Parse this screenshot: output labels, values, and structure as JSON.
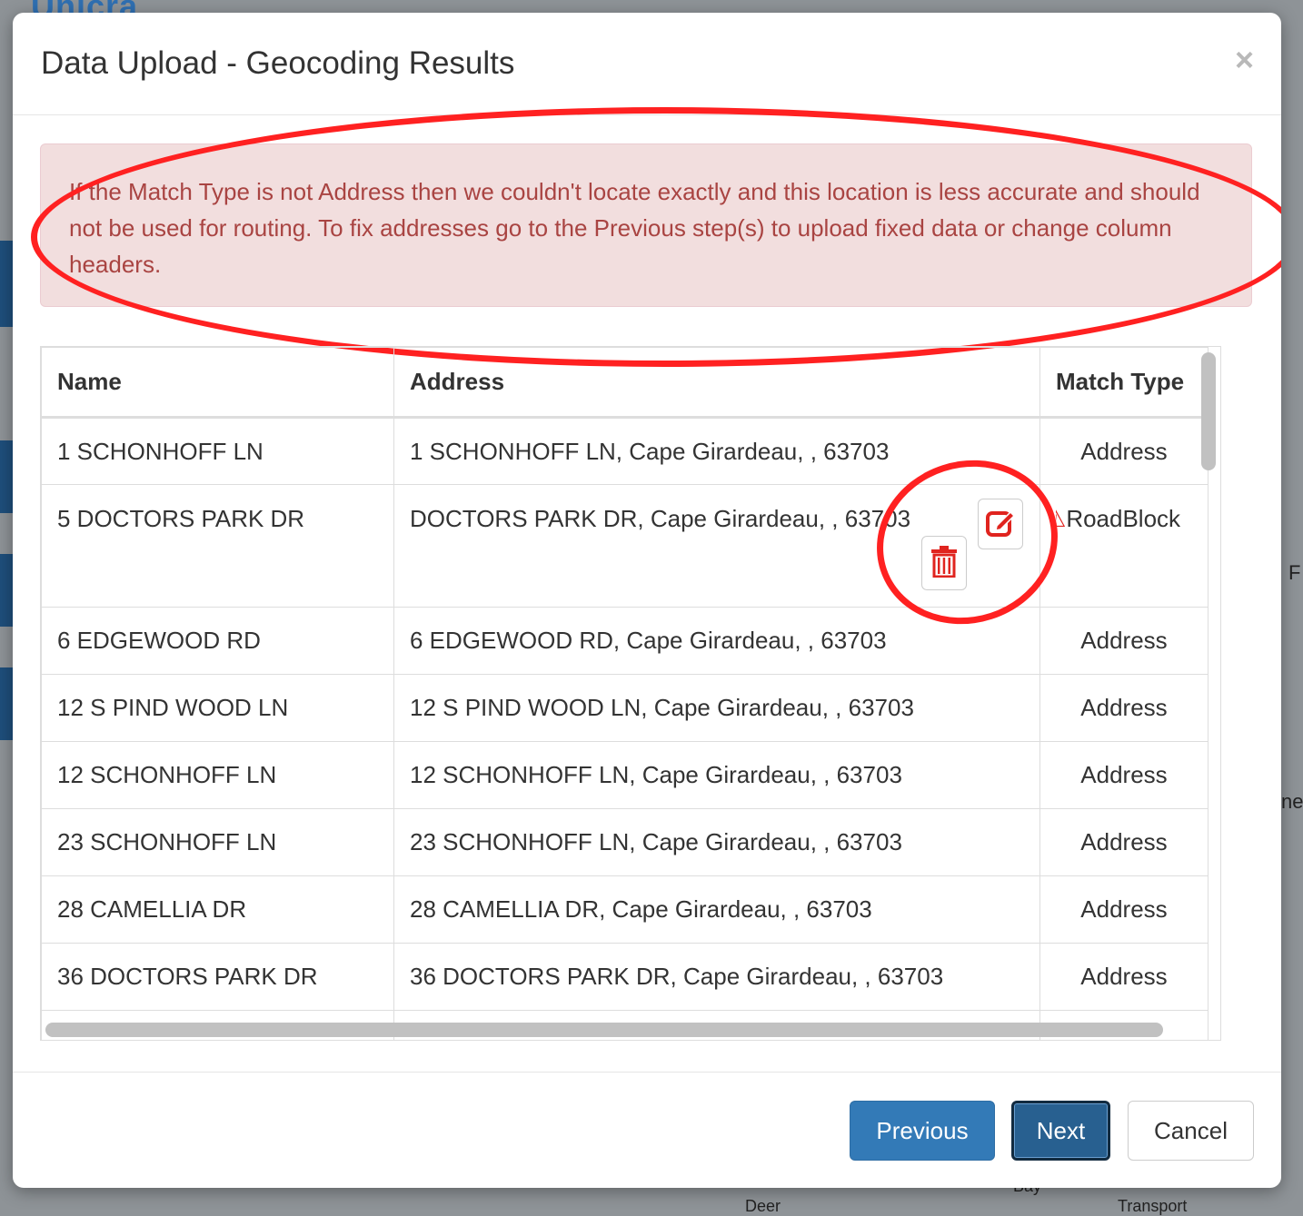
{
  "background": {
    "logo_text": "Unicra",
    "side_text_1": "F",
    "side_text_2": "ne",
    "side_text_3": "Deer",
    "side_text_4": "Bay",
    "side_text_5": "Transport"
  },
  "modal": {
    "title": "Data Upload - Geocoding Results",
    "close_label": "×",
    "alert_text": "If the Match Type is not Address then we couldn't locate exactly and this location is less accurate and should not be used for routing. To fix addresses go to the Previous step(s) to upload fixed data or change column headers.",
    "table": {
      "headers": [
        "Name",
        "Address",
        "Match Type"
      ],
      "rows": [
        {
          "name": "1 SCHONHOFF LN",
          "address": "1 SCHONHOFF LN, Cape Girardeau, , 63703",
          "match": "Address"
        },
        {
          "name": "5 DOCTORS PARK DR",
          "address": "DOCTORS PARK DR, Cape Girardeau, , 63703",
          "match": "RoadBlock"
        },
        {
          "name": "6 EDGEWOOD RD",
          "address": "6 EDGEWOOD RD, Cape Girardeau, , 63703",
          "match": "Address"
        },
        {
          "name": "12 S PIND WOOD LN",
          "address": "12 S PIND WOOD LN, Cape Girardeau, , 63703",
          "match": "Address"
        },
        {
          "name": "12 SCHONHOFF LN",
          "address": "12 SCHONHOFF LN, Cape Girardeau, , 63703",
          "match": "Address"
        },
        {
          "name": "23 SCHONHOFF LN",
          "address": "23 SCHONHOFF LN, Cape Girardeau, , 63703",
          "match": "Address"
        },
        {
          "name": "28 CAMELLIA DR",
          "address": "28 CAMELLIA DR, Cape Girardeau, , 63703",
          "match": "Address"
        },
        {
          "name": "36 DOCTORS PARK DR",
          "address": "36 DOCTORS PARK DR, Cape Girardeau, , 63703",
          "match": "Address"
        }
      ]
    },
    "icons": {
      "edit": "edit-icon",
      "delete": "trash-icon",
      "warning": "warning-icon"
    },
    "footer": {
      "previous_label": "Previous",
      "next_label": "Next",
      "cancel_label": "Cancel"
    }
  },
  "colors": {
    "alert_bg": "#f2dede",
    "alert_text": "#a94442",
    "primary": "#337ab7",
    "annotation": "#ff2121"
  }
}
